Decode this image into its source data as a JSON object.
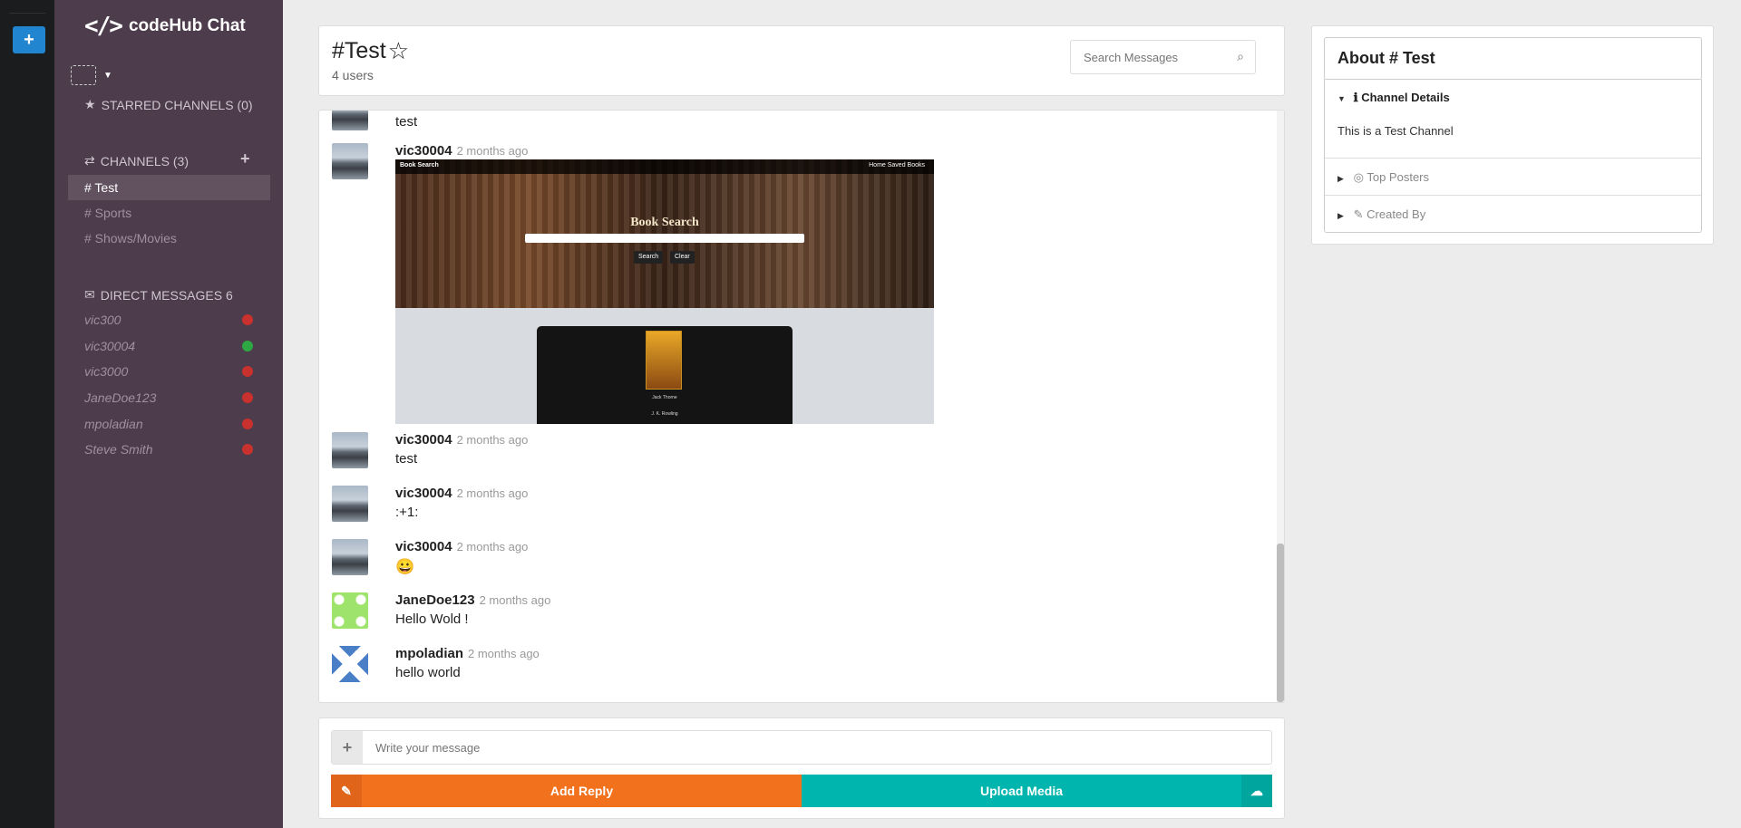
{
  "sidebar": {
    "brand": {
      "logo": "</>",
      "name": "codeHub Chat"
    },
    "starred_label": "STARRED CHANNELS (0)",
    "channels_label": "CHANNELS (3)",
    "channels": [
      {
        "label": "# Test"
      },
      {
        "label": "# Sports"
      },
      {
        "label": "# Shows/Movies"
      }
    ],
    "dm_label": "DIRECT MESSAGES 6",
    "direct_messages": [
      {
        "name": "vic300",
        "status": "offline"
      },
      {
        "name": "vic30004",
        "status": "online"
      },
      {
        "name": "vic3000",
        "status": "offline"
      },
      {
        "name": "JaneDoe123",
        "status": "offline"
      },
      {
        "name": "mpoladian",
        "status": "offline"
      },
      {
        "name": "Steve Smith",
        "status": "offline"
      }
    ]
  },
  "header": {
    "channel": "#Test",
    "user_count": "4 users",
    "search_placeholder": "Search Messages"
  },
  "messages": [
    {
      "author": "",
      "time": "",
      "text": "test"
    },
    {
      "author": "vic30004",
      "time": "2 months ago",
      "text": ""
    },
    {
      "author": "vic30004",
      "time": "2 months ago",
      "text": "test"
    },
    {
      "author": "vic30004",
      "time": "2 months ago",
      "text": ":+1:"
    },
    {
      "author": "vic30004",
      "time": "2 months ago",
      "text": "😀"
    },
    {
      "author": "JaneDoe123",
      "time": "2 months ago",
      "text": "Hello Wold !"
    },
    {
      "author": "mpoladian",
      "time": "2 months ago",
      "text": "hello world"
    }
  ],
  "media": {
    "nav_left": "Book Search",
    "nav_right": "Home    Saved Books",
    "title": "Book Search",
    "search_btn": "Search",
    "clear_btn": "Clear",
    "book_title": "Jack Thorne",
    "book_author": "J. K. Rowling"
  },
  "composer": {
    "placeholder": "Write your message",
    "reply_label": "Add Reply",
    "upload_label": "Upload Media"
  },
  "about": {
    "title": "About # Test",
    "details_label": "Channel Details",
    "description": "This is a Test Channel",
    "top_posters_label": "Top Posters",
    "created_by_label": "Created By"
  },
  "colors": {
    "sidebar_bg": "#4c3c4c",
    "rail_bg": "#1b1c1d",
    "reply_btn": "#f2711c",
    "upload_btn": "#00b5ad",
    "online": "#2ea843",
    "offline": "#c8312e"
  }
}
